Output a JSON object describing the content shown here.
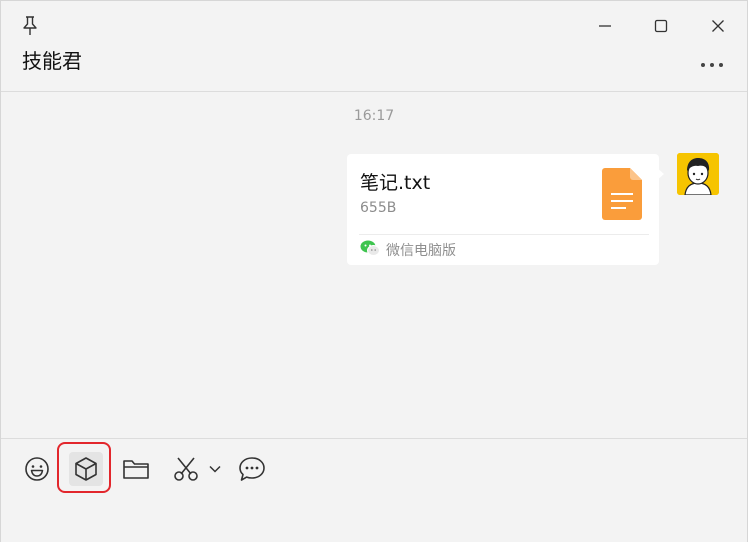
{
  "window": {
    "chat_title": "技能君",
    "icons": {
      "pin": "pin-icon",
      "minimize": "minimize-icon",
      "maximize": "maximize-icon",
      "close": "close-icon",
      "more": "more-icon"
    }
  },
  "messages": {
    "timestamp": "16:17",
    "file_message": {
      "file_name": "笔记.txt",
      "file_size": "655B",
      "source_label": "微信电脑版",
      "file_icon": "document-icon",
      "file_icon_color": "#fa9d3b",
      "source_icon": "wechat-icon"
    }
  },
  "toolbar": {
    "items": [
      {
        "name": "emoji",
        "icon": "smiley-icon"
      },
      {
        "name": "mini-program",
        "icon": "cube-icon",
        "highlighted": true
      },
      {
        "name": "file",
        "icon": "folder-icon"
      },
      {
        "name": "screenshot",
        "icon": "scissors-icon"
      },
      {
        "name": "screenshot-options",
        "icon": "chevron-down-icon"
      },
      {
        "name": "chat-history",
        "icon": "chat-bubble-icon"
      }
    ]
  },
  "colors": {
    "highlight_border": "#e2262c",
    "avatar_bg": "#f6c400"
  }
}
